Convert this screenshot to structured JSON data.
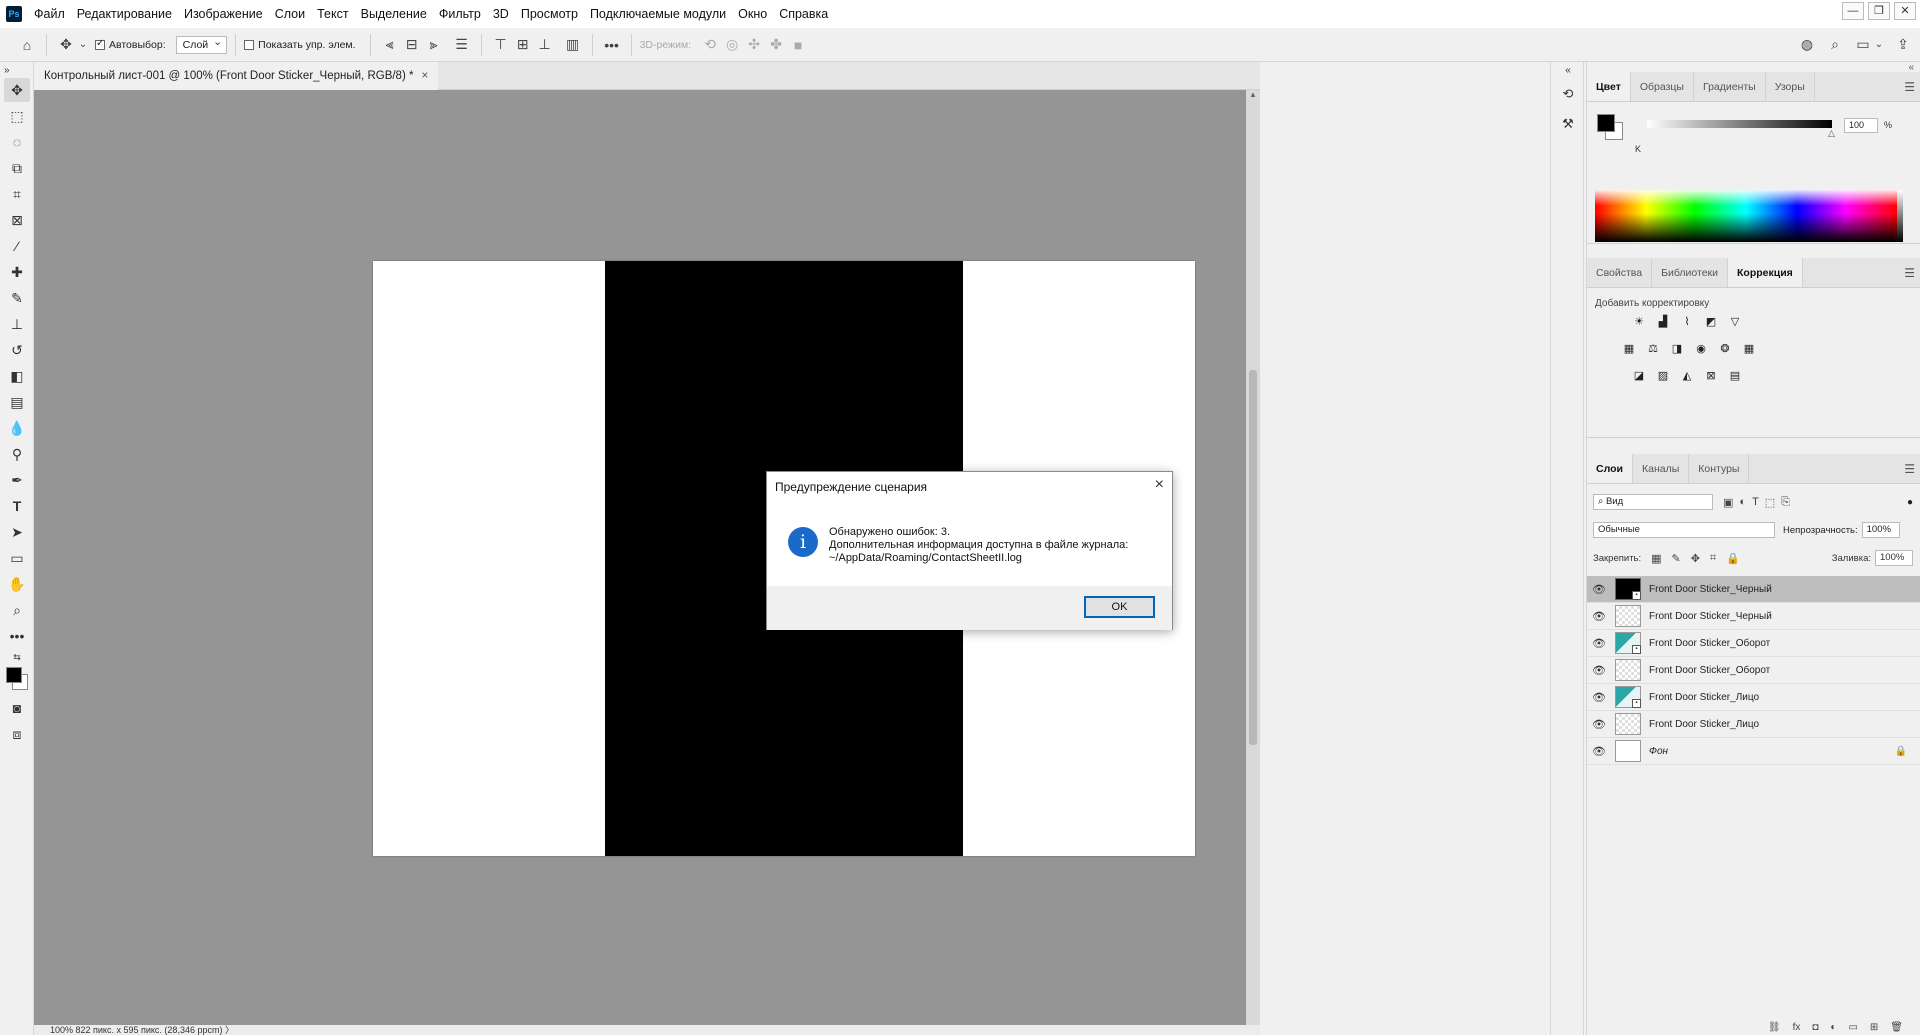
{
  "menubar": {
    "logo": "Ps",
    "items": [
      "Файл",
      "Редактирование",
      "Изображение",
      "Слои",
      "Текст",
      "Выделение",
      "Фильтр",
      "3D",
      "Просмотр",
      "Подключаемые модули",
      "Окно",
      "Справка"
    ]
  },
  "options_bar": {
    "autoselect_label": "Автовыбор:",
    "autoselect_target": "Слой",
    "show_transform_label": "Показать упр. элем.",
    "mode_3d_label": "3D-режим:"
  },
  "document": {
    "tab_title": "Контрольный лист-001 @ 100% (Front Door Sticker_Черный, RGB/8) *",
    "tab_close": "×",
    "status": "100%    822 пикс. x 595 пикс. (28,346 ppcm)   〉"
  },
  "color_panel": {
    "tabs": [
      "Цвет",
      "Образцы",
      "Градиенты",
      "Узоры"
    ],
    "active_tab": 0,
    "channel_label": "K",
    "channel_value": "100",
    "unit": "%",
    "foreground": "#000000",
    "background": "#ffffff"
  },
  "adjustments_panel": {
    "tabs": [
      "Свойства",
      "Библиотеки",
      "Коррекция"
    ],
    "active_tab": 2,
    "title": "Добавить корректировку"
  },
  "layers_panel": {
    "tabs": [
      "Слои",
      "Каналы",
      "Контуры"
    ],
    "active_tab": 0,
    "filter_value": "Вид",
    "blend_mode": "Обычные",
    "opacity_label": "Непрозрачность:",
    "opacity_value": "100%",
    "lock_label": "Закрепить:",
    "fill_label": "Заливка:",
    "fill_value": "100%",
    "layers": [
      {
        "name": "Front Door Sticker_Черный",
        "thumb": "smart-black",
        "selected": true,
        "visible": true
      },
      {
        "name": "Front Door Sticker_Черный",
        "thumb": "transparent",
        "selected": false,
        "visible": true
      },
      {
        "name": "Front Door Sticker_Оборот",
        "thumb": "smart-teal",
        "selected": false,
        "visible": true
      },
      {
        "name": "Front Door Sticker_Оборот",
        "thumb": "transparent",
        "selected": false,
        "visible": true
      },
      {
        "name": "Front Door Sticker_Лицо",
        "thumb": "smart-teal",
        "selected": false,
        "visible": true
      },
      {
        "name": "Front Door Sticker_Лицо",
        "thumb": "transparent",
        "selected": false,
        "visible": true
      },
      {
        "name": "Фон",
        "thumb": "white",
        "selected": false,
        "visible": true,
        "locked": true
      }
    ]
  },
  "dialog": {
    "title": "Предупреждение сценария",
    "close": "×",
    "line1": "Обнаружено ошибок: 3.",
    "line2": "Дополнительная информация доступна в файле журнала:",
    "line3": "~/AppData/Roaming/ContactSheetII.log",
    "ok_label": "OK"
  }
}
